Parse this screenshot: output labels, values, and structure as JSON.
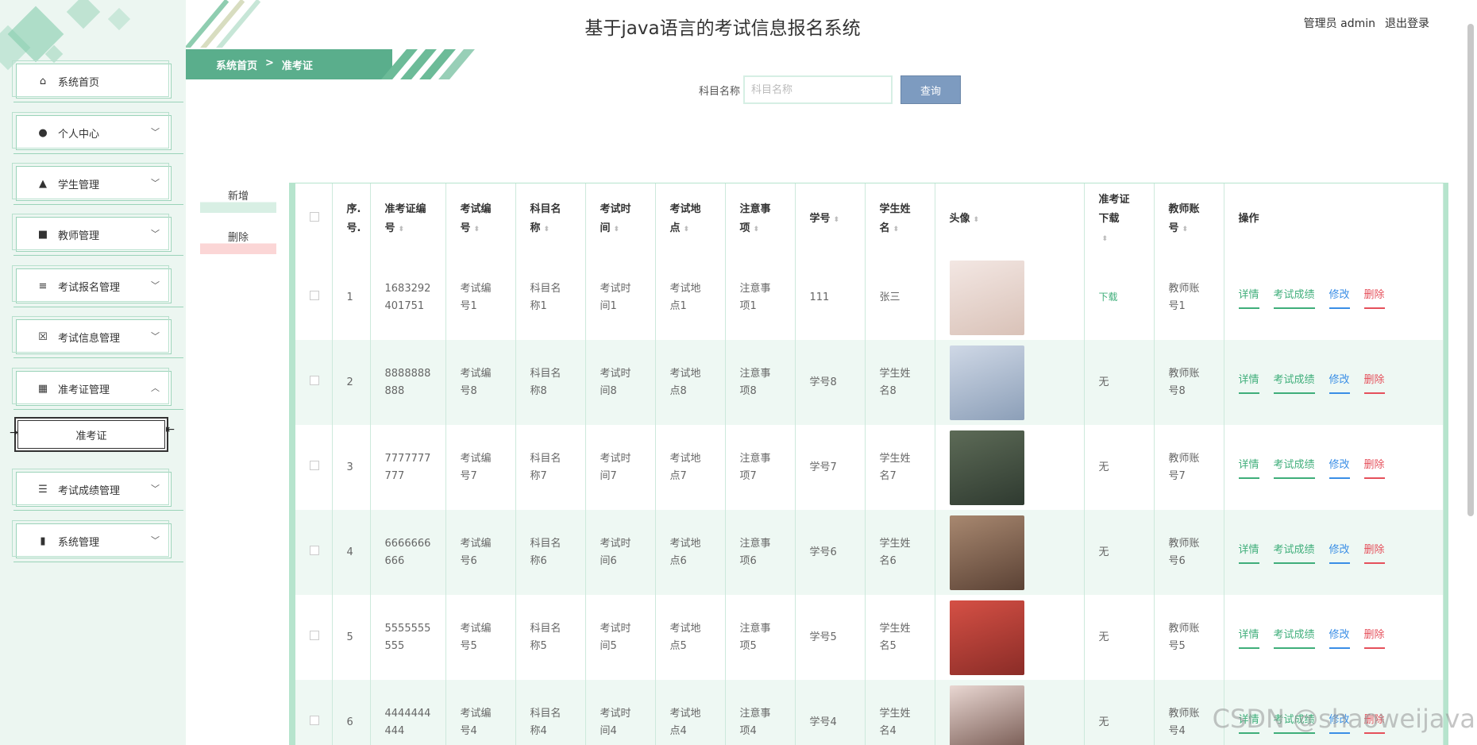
{
  "header": {
    "title": "基于java语言的考试信息报名系统",
    "user_label": "管理员 admin",
    "logout_label": "退出登录"
  },
  "breadcrumb": {
    "home": "系统首页",
    "sep": ">",
    "current": "准考证"
  },
  "sidebar": {
    "items": [
      {
        "label": "系统首页",
        "icon": "home-icon"
      },
      {
        "label": "个人中心",
        "icon": "user-icon"
      },
      {
        "label": "学生管理",
        "icon": "student-icon"
      },
      {
        "label": "教师管理",
        "icon": "briefcase-icon"
      },
      {
        "label": "考试报名管理",
        "icon": "list-icon"
      },
      {
        "label": "考试信息管理",
        "icon": "document-x-icon"
      },
      {
        "label": "准考证管理",
        "icon": "grid-icon"
      },
      {
        "label": "考试成绩管理",
        "icon": "sliders-icon"
      },
      {
        "label": "系统管理",
        "icon": "book-icon"
      }
    ],
    "sub_item": "准考证"
  },
  "search": {
    "label": "科目名称",
    "placeholder": "科目名称",
    "button": "查询"
  },
  "actions": {
    "add": "新增",
    "delete": "删除"
  },
  "table": {
    "columns": [
      "序.号.",
      "准考证编号",
      "考试编号",
      "科目名称",
      "考试时间",
      "考试地点",
      "注意事项",
      "学号",
      "学生姓名",
      "头像",
      "准考证下载",
      "教师账号",
      "操作"
    ],
    "ops": {
      "detail": "详情",
      "score": "考试成绩",
      "edit": "修改",
      "delete": "删除"
    },
    "rows": [
      {
        "no": "1",
        "ticket": "1683292401751",
        "exam_no": "考试编号1",
        "subject": "科目名称1",
        "time": "考试时间1",
        "place": "考试地点1",
        "notes": "注意事项1",
        "sid": "111",
        "sname": "张三",
        "download": "下载",
        "teacher": "教师账号1"
      },
      {
        "no": "2",
        "ticket": "8888888888",
        "exam_no": "考试编号8",
        "subject": "科目名称8",
        "time": "考试时间8",
        "place": "考试地点8",
        "notes": "注意事项8",
        "sid": "学号8",
        "sname": "学生姓名8",
        "download": "无",
        "teacher": "教师账号8"
      },
      {
        "no": "3",
        "ticket": "7777777777",
        "exam_no": "考试编号7",
        "subject": "科目名称7",
        "time": "考试时间7",
        "place": "考试地点7",
        "notes": "注意事项7",
        "sid": "学号7",
        "sname": "学生姓名7",
        "download": "无",
        "teacher": "教师账号7"
      },
      {
        "no": "4",
        "ticket": "6666666666",
        "exam_no": "考试编号6",
        "subject": "科目名称6",
        "time": "考试时间6",
        "place": "考试地点6",
        "notes": "注意事项6",
        "sid": "学号6",
        "sname": "学生姓名6",
        "download": "无",
        "teacher": "教师账号6"
      },
      {
        "no": "5",
        "ticket": "5555555555",
        "exam_no": "考试编号5",
        "subject": "科目名称5",
        "time": "考试时间5",
        "place": "考试地点5",
        "notes": "注意事项5",
        "sid": "学号5",
        "sname": "学生姓名5",
        "download": "无",
        "teacher": "教师账号5"
      },
      {
        "no": "6",
        "ticket": "4444444444",
        "exam_no": "考试编号4",
        "subject": "科目名称4",
        "time": "考试时间4",
        "place": "考试地点4",
        "notes": "注意事项4",
        "sid": "学号4",
        "sname": "学生姓名4",
        "download": "无",
        "teacher": "教师账号4"
      }
    ]
  },
  "colors": {
    "accent": "#5aae8c",
    "link_green": "#3fae7a",
    "link_blue": "#3a8ee6",
    "link_red": "#e5505b",
    "row_alt": "#eef8f3"
  },
  "watermark": "CSDN @shaoweijava"
}
